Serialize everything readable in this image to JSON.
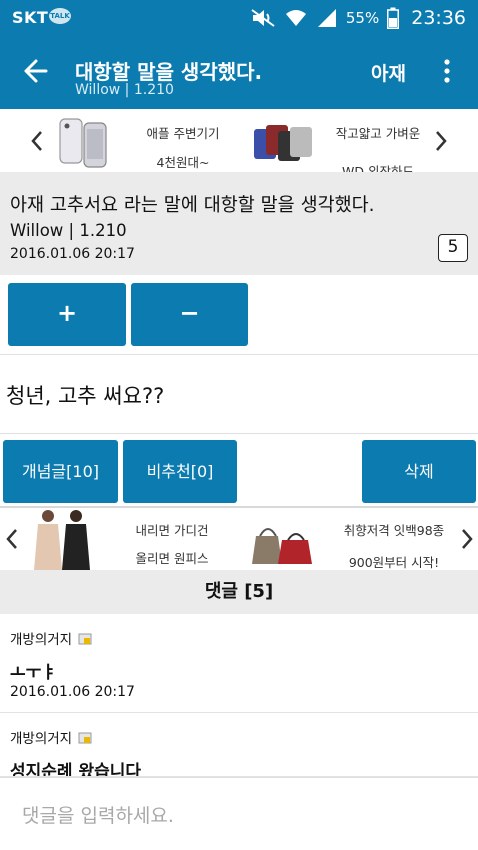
{
  "status_bar": {
    "carrier": "SKT",
    "talk_badge": "TALK",
    "battery_percent": "55%",
    "time": "23:36",
    "icons": [
      "mute-icon",
      "wifi-icon",
      "signal-icon",
      "battery-icon"
    ]
  },
  "app_bar": {
    "title": "대항할 말을 생각했다.",
    "subtitle": "Willow | 1.210",
    "title_secondary": "아재",
    "icons": [
      "back-arrow-icon",
      "more-vert-icon"
    ]
  },
  "ad_banner_top": {
    "items": [
      {
        "line1": "애플 주변기기",
        "line2": "4천원대~"
      },
      {
        "line1": "작고얇고 가벼운",
        "line2": "WD 외장하드"
      }
    ]
  },
  "post": {
    "title": "아재 고추서요 라는 말에 대항할 말을 생각했다.",
    "author_line": "Willow | 1.210",
    "date": "2016.01.06 20:17",
    "comment_count": "5",
    "body": "청년, 고추 써요??"
  },
  "vote": {
    "up_label": "+",
    "down_label": "−"
  },
  "actions": {
    "recommend_label": "개념글[10]",
    "downvote_label": "비추천[0]",
    "delete_label": "삭제"
  },
  "ad_banner_bottom": {
    "items": [
      {
        "line1": "내리면 가디건",
        "line2": "올리면 원피스"
      },
      {
        "line1": "취향저격 잇백98종",
        "line2": "900원부터 시작!"
      }
    ]
  },
  "comments": {
    "header": "댓글 [5]",
    "items": [
      {
        "author": "개방의거지",
        "text": "ㅗㅜㅑ",
        "date": "2016.01.06 20:17"
      },
      {
        "author": "개방의거지",
        "text": "성지순례 왔습니다",
        "date": ""
      }
    ]
  },
  "comment_input": {
    "placeholder": "댓글을 입력하세요."
  },
  "colors": {
    "brand": "#0b7bb0",
    "header_bg": "#ebebeb"
  }
}
